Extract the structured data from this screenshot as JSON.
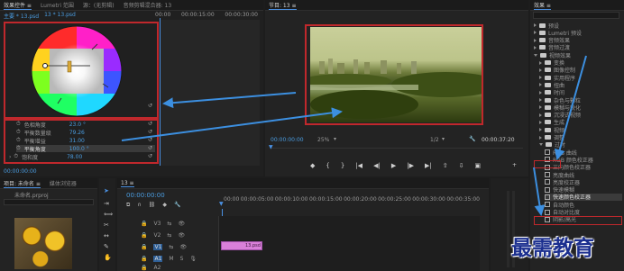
{
  "effect_controls": {
    "tabs": [
      "效果控件 ≡",
      "Lumetri 范围",
      "源：(无剪辑)",
      "音频剪辑混合器: 13"
    ],
    "clip_label": "主要 * 13.psd",
    "sequence_label": "13 * 13.psd",
    "params": [
      {
        "name": "色相角度",
        "value": "23.0 °"
      },
      {
        "name": "平衡数量级",
        "value": "79.26"
      },
      {
        "name": "平衡增益",
        "value": "31.00"
      },
      {
        "name": "平衡角度",
        "value": "100.0 °"
      },
      {
        "name": "饱和度",
        "value": "78.00"
      }
    ],
    "timeline_times": [
      "00:00",
      "00:00:15:00",
      "00:00:30:00"
    ],
    "current_time": "00:00:00:00"
  },
  "program_monitor": {
    "title": "节目: 13 ≡",
    "timecode_current": "00:00:00:00",
    "zoom": "25%",
    "quality": "1/2",
    "timecode_duration": "00:00:37:20"
  },
  "effects_panel": {
    "title": "效果 ≡",
    "items": [
      {
        "label": "预设",
        "kind": "folder",
        "level": 0
      },
      {
        "label": "Lumetri 预设",
        "kind": "folder",
        "level": 0
      },
      {
        "label": "音频效果",
        "kind": "folder",
        "level": 0
      },
      {
        "label": "音频过渡",
        "kind": "folder",
        "level": 0
      },
      {
        "label": "视频效果",
        "kind": "folder-open",
        "level": 0
      },
      {
        "label": "变换",
        "kind": "folder",
        "level": 1
      },
      {
        "label": "图像控制",
        "kind": "folder",
        "level": 1
      },
      {
        "label": "实用程序",
        "kind": "folder",
        "level": 1
      },
      {
        "label": "扭曲",
        "kind": "folder",
        "level": 1
      },
      {
        "label": "时间",
        "kind": "folder",
        "level": 1
      },
      {
        "label": "杂色与颗粒",
        "kind": "folder",
        "level": 1
      },
      {
        "label": "模糊与锐化",
        "kind": "folder",
        "level": 1
      },
      {
        "label": "沉浸式视频",
        "kind": "folder",
        "level": 1
      },
      {
        "label": "生成",
        "kind": "folder",
        "level": 1
      },
      {
        "label": "视频",
        "kind": "folder",
        "level": 1
      },
      {
        "label": "调整",
        "kind": "folder",
        "level": 1
      },
      {
        "label": "过时",
        "kind": "folder-open",
        "level": 1
      },
      {
        "label": "RGB 曲线",
        "kind": "preset",
        "level": 2
      },
      {
        "label": "RGB 颜色校正器",
        "kind": "preset",
        "level": 2
      },
      {
        "label": "三向颜色校正器",
        "kind": "preset",
        "level": 2
      },
      {
        "label": "亮度曲线",
        "kind": "preset",
        "level": 2
      },
      {
        "label": "亮度校正器",
        "kind": "preset",
        "level": 2
      },
      {
        "label": "快速模糊",
        "kind": "preset",
        "level": 2
      },
      {
        "label": "快速颜色校正器",
        "kind": "preset",
        "level": 2,
        "selected": true
      },
      {
        "label": "自动颜色",
        "kind": "preset",
        "level": 2
      },
      {
        "label": "自动对比度",
        "kind": "preset",
        "level": 2
      },
      {
        "label": "阴影/高光",
        "kind": "preset",
        "level": 2
      }
    ]
  },
  "project_panel": {
    "tabs": [
      "项目: 未命名 ≡",
      "媒体浏览器"
    ],
    "file_label": "未命名.prproj"
  },
  "timeline": {
    "title": "13 ≡",
    "timecode": "00:00:00:00",
    "ruler_times": [
      "00:00",
      "00:00:05:00",
      "00:00:10:00",
      "00:00:15:00",
      "00:00:20:00",
      "00:00:25:00",
      "00:00:30:00",
      "00:00:35:00"
    ],
    "tracks": [
      "V3",
      "V2",
      "V1",
      "A1",
      "A2"
    ],
    "clip_label": "13.psd"
  },
  "watermark": "最需教育"
}
